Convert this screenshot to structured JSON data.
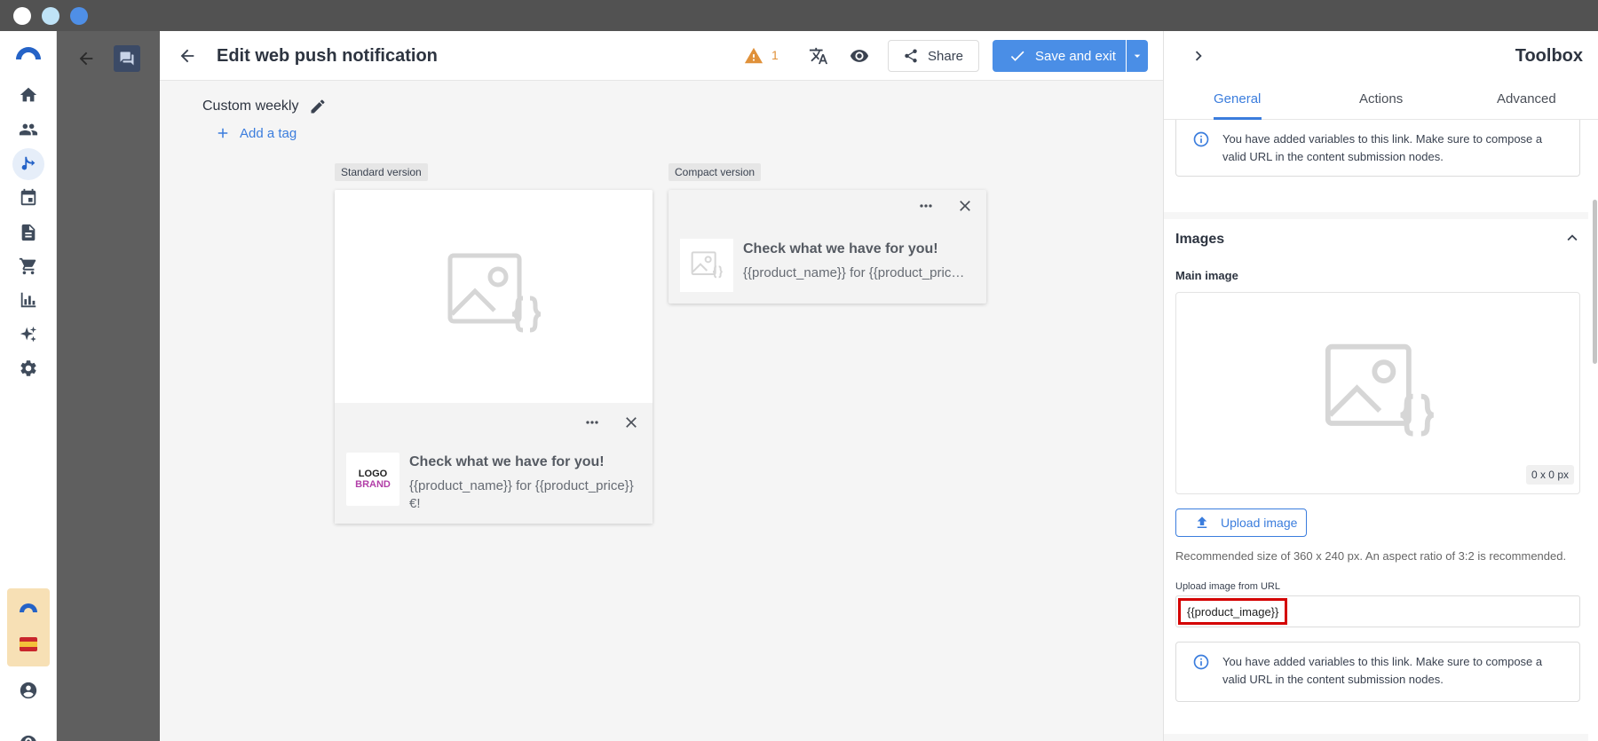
{
  "modal": {
    "title": "Edit web push notification",
    "warning_count": "1",
    "share_label": "Share",
    "save_label": "Save and exit",
    "campaign_name": "Custom weekly",
    "add_tag_label": "Add a tag"
  },
  "preview": {
    "standard_label": "Standard version",
    "compact_label": "Compact version",
    "notification_title": "Check what we have for you!",
    "notification_body_full": "{{product_name}} for {{product_price}} €!",
    "notification_body_truncated": "{{product_name}} for {{product_pric…",
    "logo_line1": "LOGO",
    "logo_line2": "BRAND"
  },
  "toolbox": {
    "title": "Toolbox",
    "tabs": [
      "General",
      "Actions",
      "Advanced"
    ],
    "active_tab": "General",
    "variables_notice": "You have added variables to this link. Make sure to compose a valid URL in the content submission nodes.",
    "images_section": "Images",
    "main_image_label": "Main image",
    "image_size": "0 x 0 px",
    "upload_button": "Upload image",
    "recommendation": "Recommended size of 360 x 240 px. An aspect ratio of 3:2 is recommended.",
    "url_label": "Upload image from URL",
    "url_value": "{{product_image}}"
  },
  "colors": {
    "accent": "#4a8ee6",
    "link": "#3b7ddd",
    "warning": "#e0913a",
    "highlight_border": "#d40000"
  }
}
